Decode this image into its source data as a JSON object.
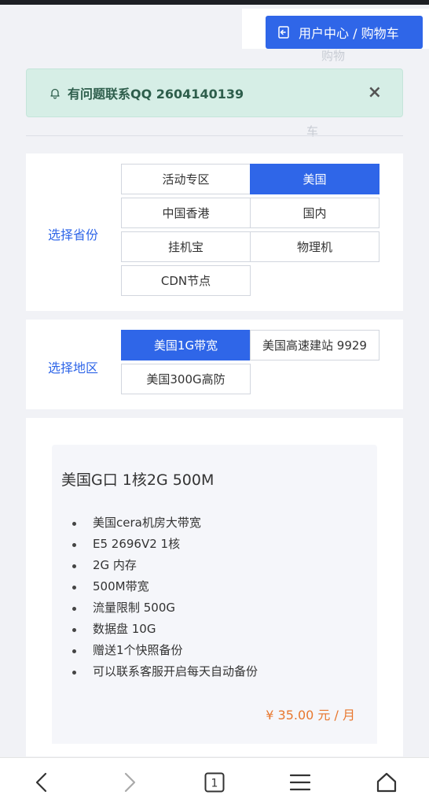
{
  "header": {
    "user_center_label": "用户中心 / 购物车",
    "overflow_1": "购物",
    "overflow_2": "车"
  },
  "alert": {
    "message": "有问题联系QQ 2604140139",
    "close_symbol": "×"
  },
  "province": {
    "label": "选择省份",
    "options": [
      "活动专区",
      "美国",
      "中国香港",
      "国内",
      "挂机宝",
      "物理机",
      "CDN节点"
    ],
    "selected": "美国"
  },
  "region": {
    "label": "选择地区",
    "options": [
      "美国1G带宽",
      "美国高速建站 9929",
      "美国300G高防"
    ],
    "selected": "美国1G带宽"
  },
  "product": {
    "title": "美国G口 1核2G 500M",
    "features": [
      "美国cera机房大带宽",
      "E5 2696V2 1核",
      "2G 内存",
      "500M带宽",
      "流量限制 500G",
      "数据盘 10G",
      "赠送1个快照备份",
      "可以联系客服开启每天自动备份"
    ],
    "price": "¥ 35.00 元 / 月"
  },
  "bottom_nav": {
    "tab_count": "1"
  },
  "colors": {
    "primary": "#2f66e8",
    "alert_bg": "#d6eee6",
    "price": "#e8772e"
  },
  "icons": [
    "logout-icon",
    "bell-icon",
    "close-icon",
    "back-icon",
    "forward-icon",
    "tabs-icon",
    "menu-icon",
    "home-icon"
  ]
}
